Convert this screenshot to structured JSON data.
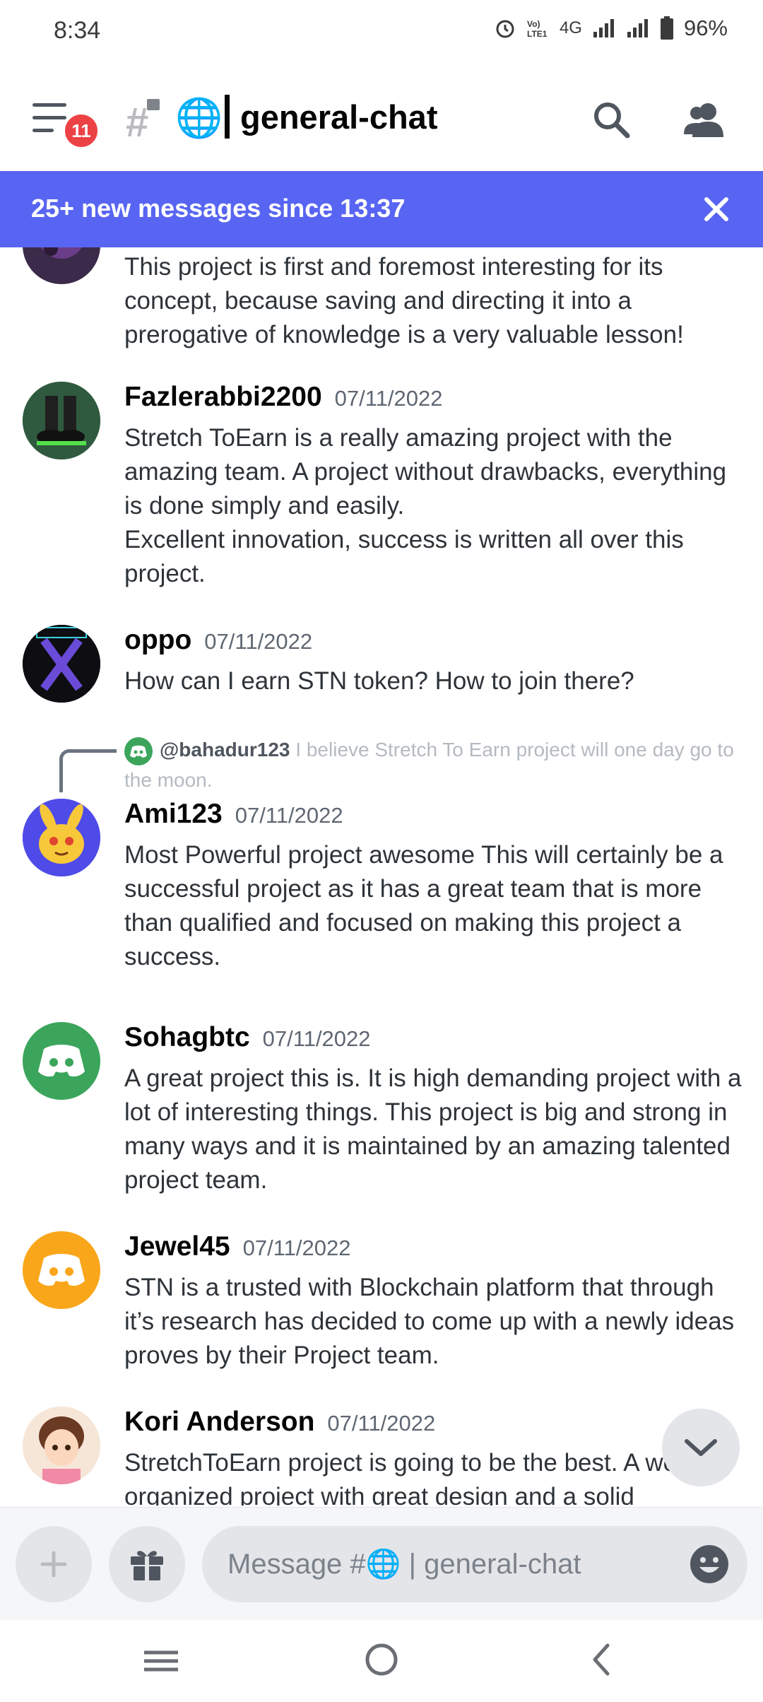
{
  "status_bar": {
    "time": "8:34",
    "network": "4G",
    "battery": "96%",
    "icons": [
      "alarm-icon",
      "volte-icon",
      "signal-icon",
      "signal-icon",
      "battery-icon"
    ]
  },
  "header": {
    "notification_count": "11",
    "channel_emoji": "🌐",
    "channel_name": "general-chat"
  },
  "new_messages_banner": {
    "text": "25+ new messages since 13:37"
  },
  "messages": [
    {
      "author": "",
      "date": "",
      "text": "This project is first and foremost interesting for its concept, because saving and directing it into a prerogative of knowledge is a very valuable lesson!"
    },
    {
      "author": "Fazlerabbi2200",
      "date": "07/11/2022",
      "text": "Stretch ToEarn is a really amazing project with the amazing team. A project without drawbacks, everything is done simply and easily.",
      "text2": "Excellent innovation, success is written all over this project."
    },
    {
      "author": "oppo",
      "date": "07/11/2022",
      "text": "How can I earn STN token? How to join there?"
    },
    {
      "reply_user": "@bahadur123",
      "reply_text": "I believe Stretch To Earn project will one day go to the moon.",
      "author": "Ami123",
      "date": "07/11/2022",
      "text": "Most Powerful project awesome This will certainly be a successful project as it has a great team that is more than qualified and focused on making this project a success."
    },
    {
      "author": "Sohagbtc",
      "date": "07/11/2022",
      "text": "A great project this is. It is high demanding project with a lot of interesting things. This project is big and strong in many ways and it is maintained by an amazing talented project team."
    },
    {
      "author": "Jewel45",
      "date": "07/11/2022",
      "text": "STN is a trusted with Blockchain platform that through it’s research has decided to come up with a newly ideas proves by their Project team."
    },
    {
      "author": "Kori Anderson",
      "date": "07/11/2022",
      "text": "StretchToEarn  project is going to be the best. A well-organized project with great design and a solid"
    }
  ],
  "composer": {
    "placeholder": "Message #🌐 | general-chat"
  },
  "colors": {
    "blurple": "#5865f2",
    "discord_green": "#3ba55c",
    "discord_orange": "#faa61a",
    "badge_red": "#ed4245"
  }
}
